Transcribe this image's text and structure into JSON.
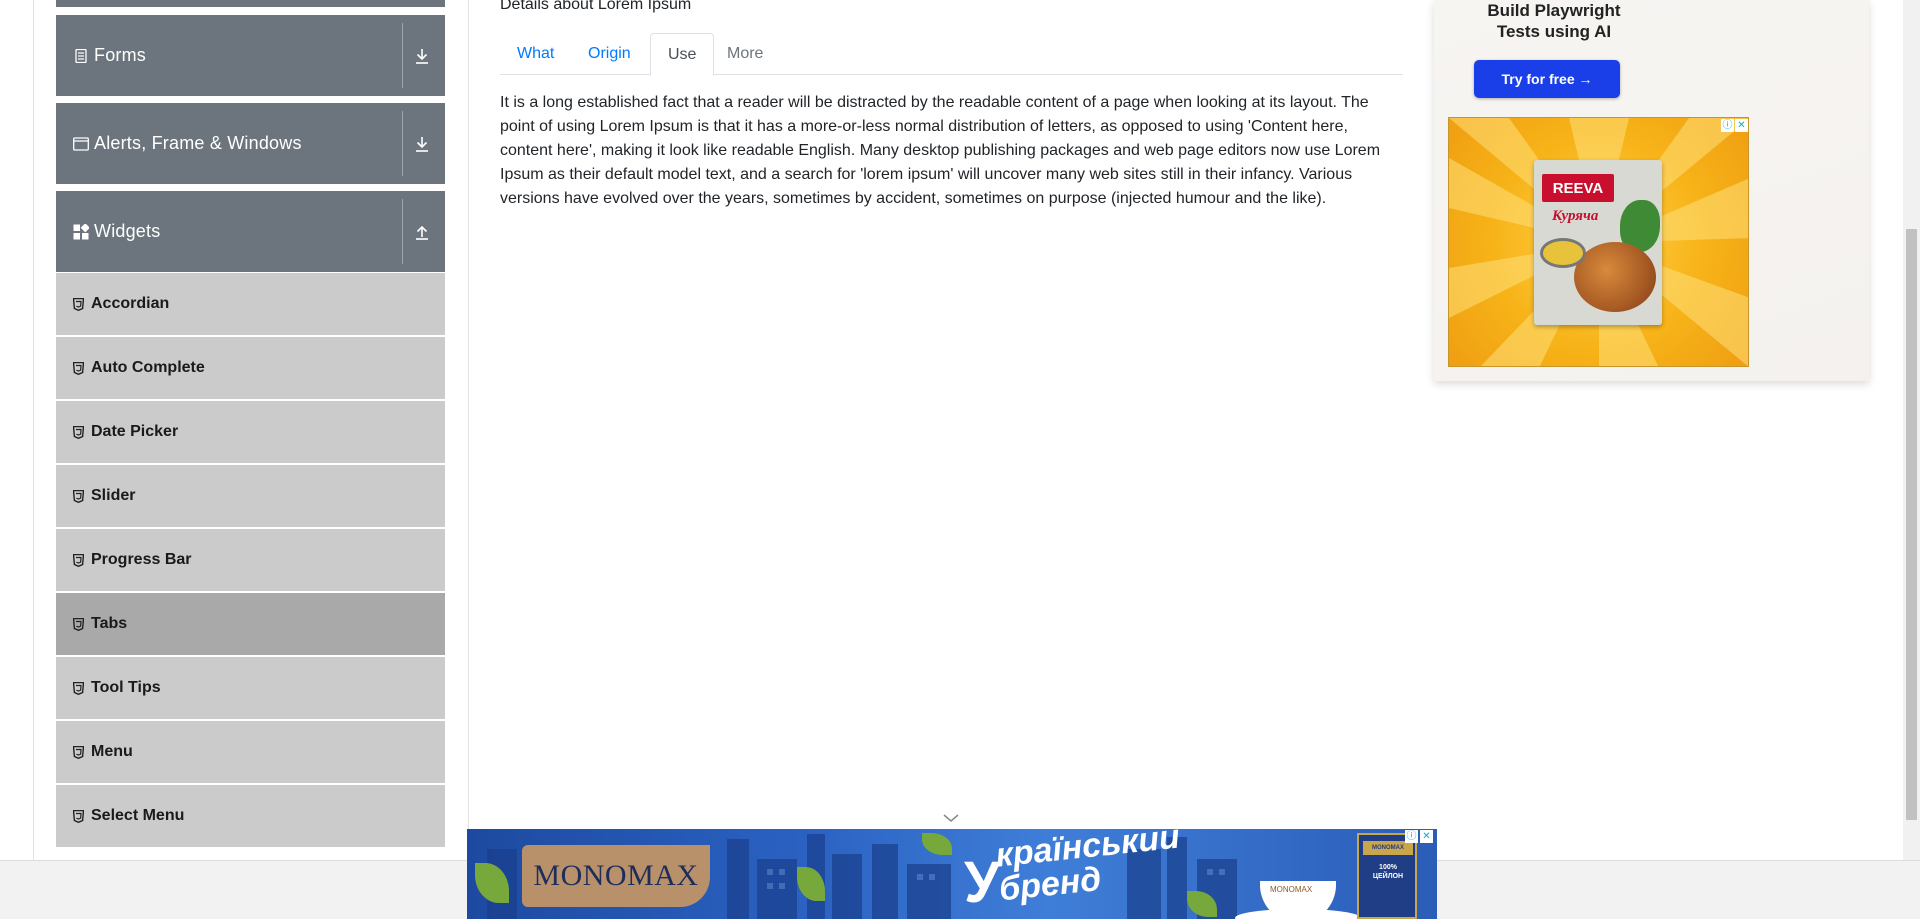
{
  "sidebar": {
    "groups": [
      {
        "label": "Forms",
        "icon": "document-icon",
        "toggle": "download-arrow-icon"
      },
      {
        "label": "Alerts, Frame & Windows",
        "icon": "window-icon",
        "toggle": "download-arrow-icon"
      },
      {
        "label": "Widgets",
        "icon": "widgets-icon",
        "toggle": "upload-arrow-icon"
      }
    ],
    "items": [
      {
        "label": "Accordian"
      },
      {
        "label": "Auto Complete"
      },
      {
        "label": "Date Picker"
      },
      {
        "label": "Slider"
      },
      {
        "label": "Progress Bar"
      },
      {
        "label": "Tabs",
        "active": true
      },
      {
        "label": "Tool Tips"
      },
      {
        "label": "Menu"
      },
      {
        "label": "Select Menu"
      }
    ]
  },
  "main": {
    "subtitle": "Details about Lorem Ipsum",
    "tabs": [
      {
        "label": "What"
      },
      {
        "label": "Origin"
      },
      {
        "label": "Use",
        "active": true
      },
      {
        "label": "More",
        "disabled": true
      }
    ],
    "content": "It is a long established fact that a reader will be distracted by the readable content of a page when looking at its layout. The point of using Lorem Ipsum is that it has a more-or-less normal distribution of letters, as opposed to using 'Content here, content here', making it look like readable English. Many desktop publishing packages and web page editors now use Lorem Ipsum as their default model text, and a search for 'lorem ipsum' will uncover many web sites still in their infancy. Various versions have evolved over the years, sometimes by accident, sometimes on purpose (injected humour and the like)."
  },
  "ad_right": {
    "title_line1": "Build Playwright",
    "title_line2": "Tests using AI",
    "cta": "Try for free →",
    "product_brand": "REEVA",
    "product_name": "Куряча"
  },
  "ad_bottom": {
    "brand": "MONOMAX",
    "slogan_initial": "У",
    "slogan_line1": "країнський",
    "slogan_line2": "бренд",
    "cup_label": "MONOMAX",
    "box_brand": "MONOMAX",
    "box_text": "100% ЦЕЙЛОН"
  },
  "colors": {
    "sidebar_group": "#6c757d",
    "sidebar_item": "#cbcbcb",
    "sidebar_item_active": "#a9a9a9",
    "link": "#007bff",
    "cta": "#1a3ee8"
  }
}
